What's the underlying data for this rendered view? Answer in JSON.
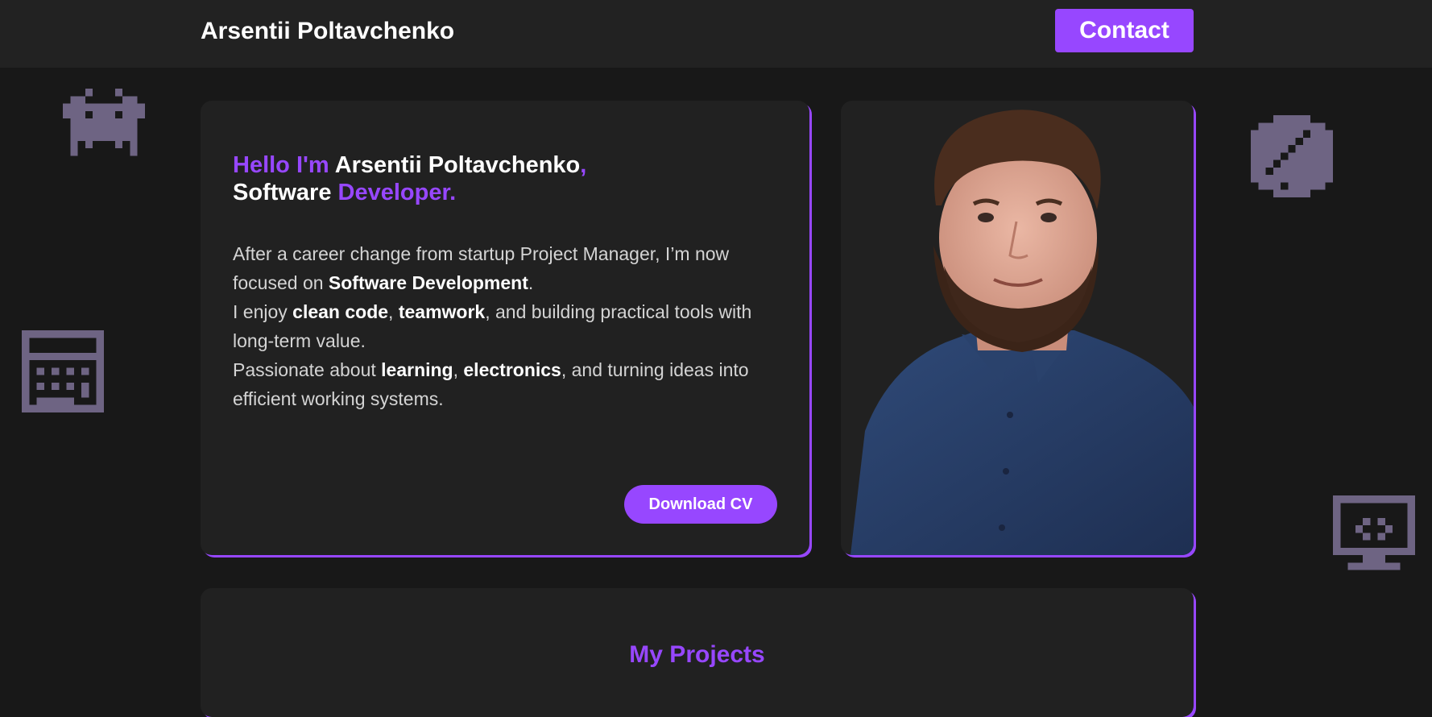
{
  "header": {
    "brand": "Arsentii Poltavchenko",
    "contact_label": "Contact"
  },
  "hero": {
    "greeting_hello": "Hello I'm ",
    "greeting_name": "Arsentii Poltavchenko",
    "greeting_comma": ",",
    "greeting_role_prefix": "Software ",
    "greeting_role": "Developer.",
    "about": {
      "p1_a": "After a career change from startup Project Manager, I’m now focused on ",
      "p1_b": "Software Development",
      "p1_c": ".",
      "p2_a": "I enjoy ",
      "p2_b": "clean code",
      "p2_c": ", ",
      "p2_d": "teamwork",
      "p2_e": ", and building practical tools with long-term value.",
      "p3_a": "Passionate about ",
      "p3_b": "learning",
      "p3_c": ", ",
      "p3_d": "electronics",
      "p3_e": ", and turning ideas into efficient working systems."
    },
    "cv_label": "Download CV"
  },
  "photo": {
    "subject": "portrait-photo"
  },
  "projects": {
    "title": "My Projects"
  },
  "decorations": [
    "space-invader-icon",
    "calculator-icon",
    "chip-icon",
    "monitor-icon"
  ],
  "colors": {
    "accent": "#9747ff",
    "background": "#181818",
    "card": "#212121",
    "header": "#222222",
    "icon": "#6e6483"
  }
}
